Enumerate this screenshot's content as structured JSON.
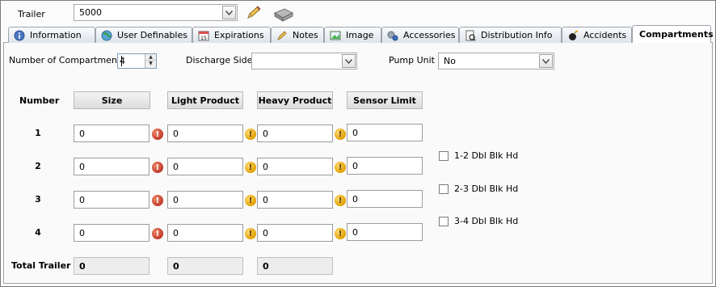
{
  "trailer": {
    "label": "Trailer",
    "value": "5000"
  },
  "tabs": [
    {
      "label": "Information",
      "icon": "info-icon"
    },
    {
      "label": "User Definables",
      "icon": "globe-icon"
    },
    {
      "label": "Expirations",
      "icon": "calendar-icon"
    },
    {
      "label": "Notes",
      "icon": "pencil-icon"
    },
    {
      "label": "Image",
      "icon": "image-icon"
    },
    {
      "label": "Accessories",
      "icon": "wrench-icon"
    },
    {
      "label": "Distribution Info",
      "icon": "report-icon"
    },
    {
      "label": "Accidents",
      "icon": "bomb-icon"
    },
    {
      "label": "Compartments",
      "icon": "",
      "active": true
    }
  ],
  "form": {
    "num_compartments_label": "Number of Compartments",
    "num_compartments_value": "4",
    "discharge_side_label": "Discharge Side",
    "discharge_side_value": "",
    "pump_unit_label": "Pump Unit",
    "pump_unit_value": "No"
  },
  "grid": {
    "number_header": "Number",
    "columns": [
      "Size",
      "Light Product",
      "Heavy Product",
      "Sensor Limit"
    ],
    "rows": [
      {
        "number": "1",
        "values": [
          "0",
          "0",
          "0",
          "0"
        ]
      },
      {
        "number": "2",
        "values": [
          "0",
          "0",
          "0",
          "0"
        ]
      },
      {
        "number": "3",
        "values": [
          "0",
          "0",
          "0",
          "0"
        ]
      },
      {
        "number": "4",
        "values": [
          "0",
          "0",
          "0",
          "0"
        ]
      }
    ],
    "total_label": "Total Trailer",
    "totals": [
      "0",
      "0",
      "0"
    ]
  },
  "bulkheads": [
    {
      "label": "1-2 Dbl Blk Hd",
      "checked": false
    },
    {
      "label": "2-3 Dbl Blk Hd",
      "checked": false
    },
    {
      "label": "3-4 Dbl Blk Hd",
      "checked": false
    }
  ],
  "colors": {
    "error": "#c0392b",
    "warning": "#e0a000",
    "tab_border": "#9da4ad"
  }
}
